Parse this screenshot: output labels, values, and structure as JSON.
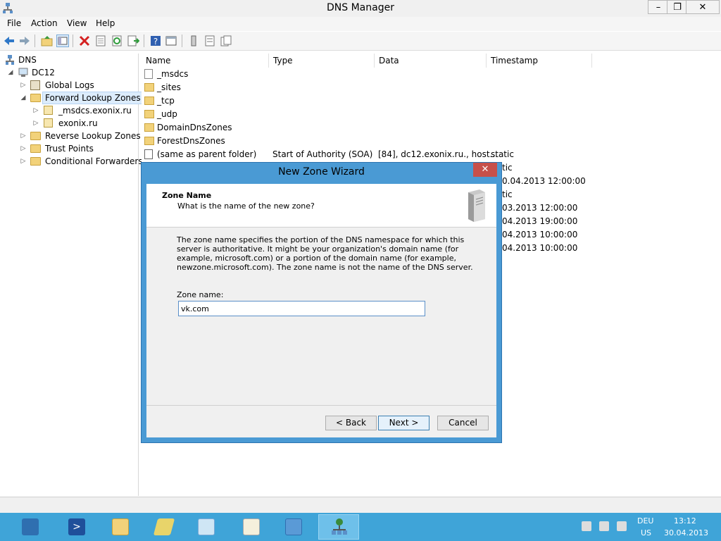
{
  "window": {
    "title": "DNS Manager"
  },
  "window_controls": {
    "minimize": "–",
    "restore": "❐",
    "close": "✕"
  },
  "menu": [
    "File",
    "Action",
    "View",
    "Help"
  ],
  "tree": {
    "root": "DNS",
    "server": "DC12",
    "items": [
      {
        "label": "Global Logs"
      },
      {
        "label": "Forward Lookup Zones"
      },
      {
        "label": "_msdcs.exonix.ru"
      },
      {
        "label": "exonix.ru"
      },
      {
        "label": "Reverse Lookup Zones"
      },
      {
        "label": "Trust Points"
      },
      {
        "label": "Conditional Forwarders"
      }
    ]
  },
  "list": {
    "columns": [
      "Name",
      "Type",
      "Data",
      "Timestamp"
    ],
    "rows": [
      {
        "name": "_msdcs",
        "type": "",
        "data": "",
        "timestamp": "",
        "icon": "zone-icon"
      },
      {
        "name": "_sites",
        "type": "",
        "data": "",
        "timestamp": "",
        "icon": "folder-icon"
      },
      {
        "name": "_tcp",
        "type": "",
        "data": "",
        "timestamp": "",
        "icon": "folder-icon"
      },
      {
        "name": "_udp",
        "type": "",
        "data": "",
        "timestamp": "",
        "icon": "folder-icon"
      },
      {
        "name": "DomainDnsZones",
        "type": "",
        "data": "",
        "timestamp": "",
        "icon": "folder-icon"
      },
      {
        "name": "ForestDnsZones",
        "type": "",
        "data": "",
        "timestamp": "",
        "icon": "folder-icon"
      },
      {
        "name": "(same as parent folder)",
        "type": "Start of Authority (SOA)",
        "data": "[84], dc12.exonix.ru., host...",
        "timestamp": "static",
        "icon": "record-icon"
      }
    ],
    "visible_timestamps": [
      "tic",
      "0.04.2013 12:00:00",
      "tic",
      "03.2013 12:00:00",
      "04.2013 19:00:00",
      "04.2013 10:00:00",
      "04.2013 10:00:00"
    ]
  },
  "dialog": {
    "title": "New Zone Wizard",
    "close": "✕",
    "heading": "Zone Name",
    "subheading": "What is the name of the new zone?",
    "description": "The zone name specifies the portion of the DNS namespace for which this server is authoritative. It might be your organization's domain name (for example,  microsoft.com) or a portion of the domain name (for example, newzone.microsoft.com). The zone name is not the name of the DNS server.",
    "field_label": "Zone name:",
    "field_value": "vk.com",
    "back": "< Back",
    "next": "Next >",
    "cancel": "Cancel"
  },
  "tray": {
    "lang1": "DEU",
    "lang2": "US",
    "time": "13:12",
    "date": "30.04.2013"
  },
  "colors": {
    "taskbar": "#3fa4d8",
    "dialog_frame": "#4a9ad4",
    "close_red": "#c7504a",
    "folder": "#f2d27a"
  }
}
